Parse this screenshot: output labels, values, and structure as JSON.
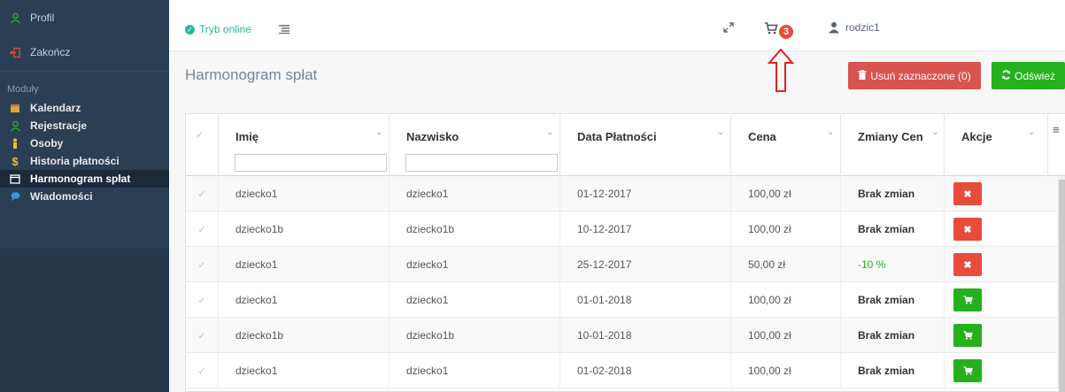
{
  "sidebar": {
    "top_items": [
      {
        "label": "Profil",
        "icon": "user-icon"
      },
      {
        "label": "Zakończ",
        "icon": "logout-icon"
      }
    ],
    "modules_label": "Moduły",
    "items": [
      {
        "label": "Kalendarz",
        "icon": "calendar-icon"
      },
      {
        "label": "Rejestracje",
        "icon": "user-icon"
      },
      {
        "label": "Osoby",
        "icon": "person-icon"
      },
      {
        "label": "Historia płatności",
        "icon": "dollar-icon"
      },
      {
        "label": "Harmonogram spłat",
        "icon": "calendar-icon",
        "active": true
      },
      {
        "label": "Wiadomości",
        "icon": "chat-icon"
      }
    ]
  },
  "topbar": {
    "status": "Tryb online",
    "cart_count": "3",
    "username": "rodzic1"
  },
  "page": {
    "title": "Harmonogram spłat",
    "delete_label": "Usuń zaznaczone (0)",
    "refresh_label": "Odśwież"
  },
  "table": {
    "columns": [
      "Imię",
      "Nazwisko",
      "Data Płatności",
      "Cena",
      "Zmiany Cen",
      "Akcje"
    ],
    "rows": [
      {
        "imie": "dziecko1",
        "nazwisko": "dziecko1",
        "data": "01-12-2017",
        "cena": "100,00 zł",
        "zmiany": "Brak zmian",
        "akcja": "delete"
      },
      {
        "imie": "dziecko1b",
        "nazwisko": "dziecko1b",
        "data": "10-12-2017",
        "cena": "100,00 zł",
        "zmiany": "Brak zmian",
        "akcja": "delete"
      },
      {
        "imie": "dziecko1",
        "nazwisko": "dziecko1",
        "data": "25-12-2017",
        "cena": "50,00 zł",
        "zmiany": "-10 %",
        "akcja": "delete"
      },
      {
        "imie": "dziecko1",
        "nazwisko": "dziecko1",
        "data": "01-01-2018",
        "cena": "100,00 zł",
        "zmiany": "Brak zmian",
        "akcja": "buy"
      },
      {
        "imie": "dziecko1b",
        "nazwisko": "dziecko1b",
        "data": "10-01-2018",
        "cena": "100,00 zł",
        "zmiany": "Brak zmian",
        "akcja": "buy"
      },
      {
        "imie": "dziecko1",
        "nazwisko": "dziecko1",
        "data": "01-02-2018",
        "cena": "100,00 zł",
        "zmiany": "Brak zmian",
        "akcja": "buy"
      }
    ]
  },
  "colors": {
    "sidebar_bg": "#2a3f54",
    "accent_green": "#26b01e",
    "danger_red": "#d9534f",
    "online_green": "#26b99a"
  }
}
